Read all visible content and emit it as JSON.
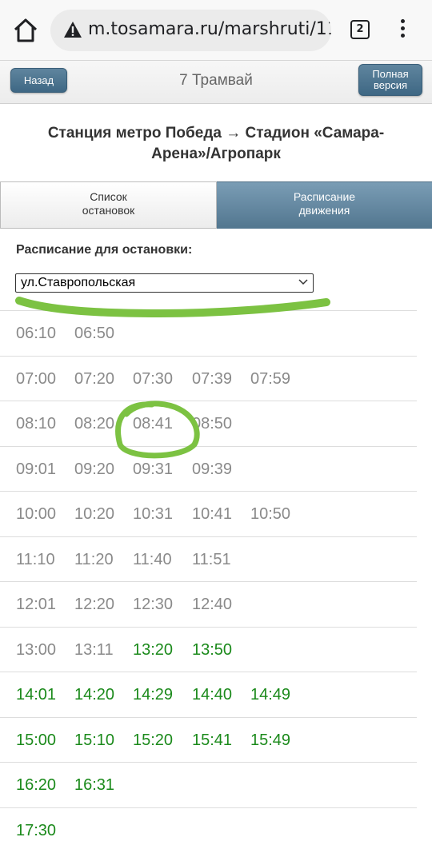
{
  "browser": {
    "url": "m.tosamara.ru/marshruti/11",
    "tab_count": "2",
    "icons": [
      "home-icon",
      "warning-icon",
      "tabs-icon",
      "menu-icon"
    ]
  },
  "header": {
    "back_label": "Назад",
    "title": "7 Трамвай",
    "full_version_label": "Полная\nверсия"
  },
  "route": {
    "title": "Станция метро Победа → Стадион «Самара-Арена»/Агропарк"
  },
  "tabs": [
    {
      "label": "Список\nостановок",
      "active": false
    },
    {
      "label": "Расписание\nдвижения",
      "active": true
    }
  ],
  "stop": {
    "label": "Расписание для остановки:",
    "selected": "ул.Ставропольская"
  },
  "timetable": [
    [
      {
        "t": "06:10",
        "f": false
      },
      {
        "t": "06:50",
        "f": false
      }
    ],
    [
      {
        "t": "07:00",
        "f": false
      },
      {
        "t": "07:20",
        "f": false
      },
      {
        "t": "07:30",
        "f": false
      },
      {
        "t": "07:39",
        "f": false
      },
      {
        "t": "07:59",
        "f": false
      }
    ],
    [
      {
        "t": "08:10",
        "f": false
      },
      {
        "t": "08:20",
        "f": false
      },
      {
        "t": "08:41",
        "f": false
      },
      {
        "t": "08:50",
        "f": false
      }
    ],
    [
      {
        "t": "09:01",
        "f": false
      },
      {
        "t": "09:20",
        "f": false
      },
      {
        "t": "09:31",
        "f": false
      },
      {
        "t": "09:39",
        "f": false
      }
    ],
    [
      {
        "t": "10:00",
        "f": false
      },
      {
        "t": "10:20",
        "f": false
      },
      {
        "t": "10:31",
        "f": false
      },
      {
        "t": "10:41",
        "f": false
      },
      {
        "t": "10:50",
        "f": false
      }
    ],
    [
      {
        "t": "11:10",
        "f": false
      },
      {
        "t": "11:20",
        "f": false
      },
      {
        "t": "11:40",
        "f": false
      },
      {
        "t": "11:51",
        "f": false
      }
    ],
    [
      {
        "t": "12:01",
        "f": false
      },
      {
        "t": "12:20",
        "f": false
      },
      {
        "t": "12:30",
        "f": false
      },
      {
        "t": "12:40",
        "f": false
      }
    ],
    [
      {
        "t": "13:00",
        "f": false
      },
      {
        "t": "13:11",
        "f": false
      },
      {
        "t": "13:20",
        "f": true
      },
      {
        "t": "13:50",
        "f": true
      }
    ],
    [
      {
        "t": "14:01",
        "f": true
      },
      {
        "t": "14:20",
        "f": true
      },
      {
        "t": "14:29",
        "f": true
      },
      {
        "t": "14:40",
        "f": true
      },
      {
        "t": "14:49",
        "f": true
      }
    ],
    [
      {
        "t": "15:00",
        "f": true
      },
      {
        "t": "15:10",
        "f": true
      },
      {
        "t": "15:20",
        "f": true
      },
      {
        "t": "15:41",
        "f": true
      },
      {
        "t": "15:49",
        "f": true
      }
    ],
    [
      {
        "t": "16:20",
        "f": true
      },
      {
        "t": "16:31",
        "f": true
      }
    ],
    [
      {
        "t": "17:30",
        "f": true
      }
    ]
  ],
  "colors": {
    "past_time": "#8a8a8a",
    "future_time": "#1b8a1b",
    "annotation": "#7cc242"
  }
}
